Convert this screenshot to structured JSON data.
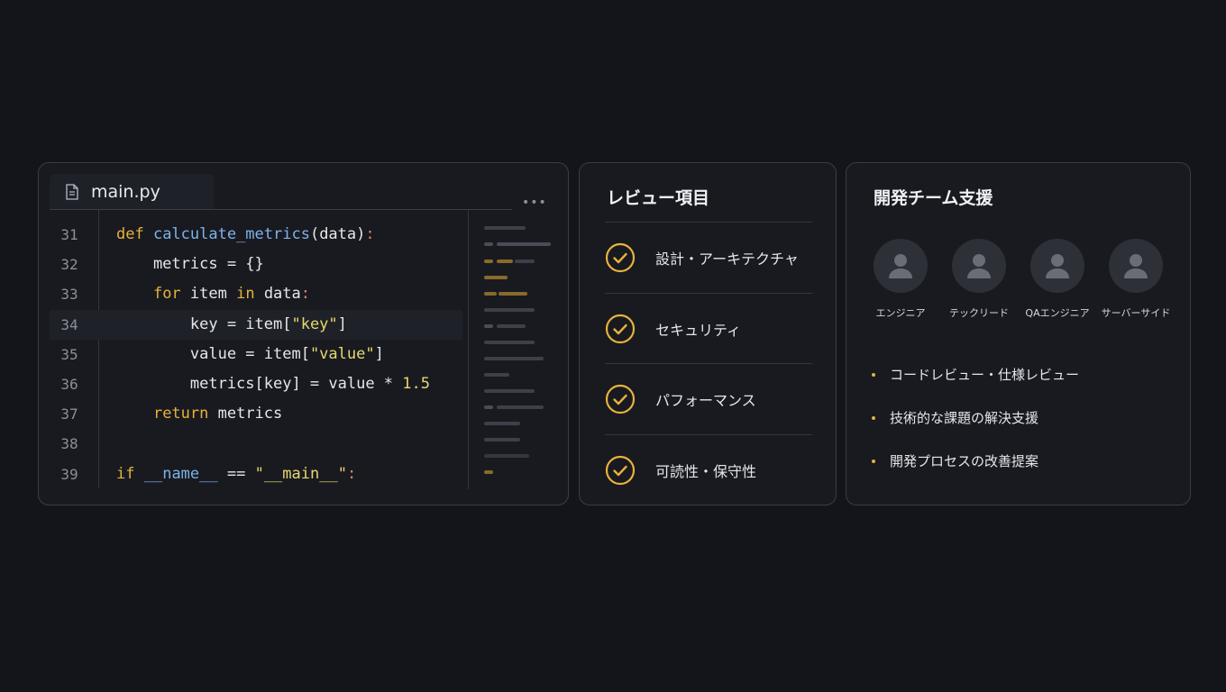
{
  "editor": {
    "tab_label": "main.py",
    "more_label": "•••",
    "lines": [
      {
        "num": "31",
        "tokens": [
          {
            "t": "def ",
            "c": "kw"
          },
          {
            "t": "calculate_metrics",
            "c": "fn"
          },
          {
            "t": "(data)",
            "c": ""
          },
          {
            "t": ":",
            "c": "punc"
          }
        ]
      },
      {
        "num": "32",
        "tokens": [
          {
            "t": "    metrics = {}",
            "c": ""
          }
        ]
      },
      {
        "num": "33",
        "tokens": [
          {
            "t": "    ",
            "c": ""
          },
          {
            "t": "for",
            "c": "kw"
          },
          {
            "t": " item ",
            "c": ""
          },
          {
            "t": "in",
            "c": "kw"
          },
          {
            "t": " data",
            "c": ""
          },
          {
            "t": ":",
            "c": "punc"
          }
        ]
      },
      {
        "num": "34",
        "tokens": [
          {
            "t": "        key = item[",
            "c": ""
          },
          {
            "t": "\"key\"",
            "c": "str"
          },
          {
            "t": "]",
            "c": ""
          }
        ]
      },
      {
        "num": "35",
        "tokens": [
          {
            "t": "        value = item[",
            "c": ""
          },
          {
            "t": "\"value\"",
            "c": "str"
          },
          {
            "t": "]",
            "c": ""
          }
        ]
      },
      {
        "num": "36",
        "tokens": [
          {
            "t": "        metrics[key] = value * ",
            "c": ""
          },
          {
            "t": "1.5",
            "c": "num"
          }
        ]
      },
      {
        "num": "37",
        "tokens": [
          {
            "t": "    ",
            "c": ""
          },
          {
            "t": "return",
            "c": "kw"
          },
          {
            "t": " metrics",
            "c": ""
          }
        ]
      },
      {
        "num": "38",
        "tokens": []
      },
      {
        "num": "39",
        "tokens": [
          {
            "t": "if",
            "c": "kw"
          },
          {
            "t": " ",
            "c": ""
          },
          {
            "t": "__name__",
            "c": "fn"
          },
          {
            "t": " == ",
            "c": ""
          },
          {
            "t": "\"__main__\"",
            "c": "str"
          },
          {
            "t": ":",
            "c": "punc"
          }
        ]
      }
    ],
    "active_line": "34"
  },
  "review": {
    "title": "レビュー項目",
    "items": [
      {
        "label": "設計・アーキテクチャ"
      },
      {
        "label": "セキュリティ"
      },
      {
        "label": "パフォーマンス"
      },
      {
        "label": "可読性・保守性"
      }
    ],
    "accent_color": "#e7b23b"
  },
  "team": {
    "title": "開発チーム支援",
    "members": [
      {
        "name": "エンジニア"
      },
      {
        "name": "テックリード"
      },
      {
        "name": "QAエンジニア"
      },
      {
        "name": "サーバーサイド"
      }
    ],
    "bullets": [
      "コードレビュー・仕様レビュー",
      "技術的な課題の解決支援",
      "開発プロセスの改善提案"
    ]
  }
}
